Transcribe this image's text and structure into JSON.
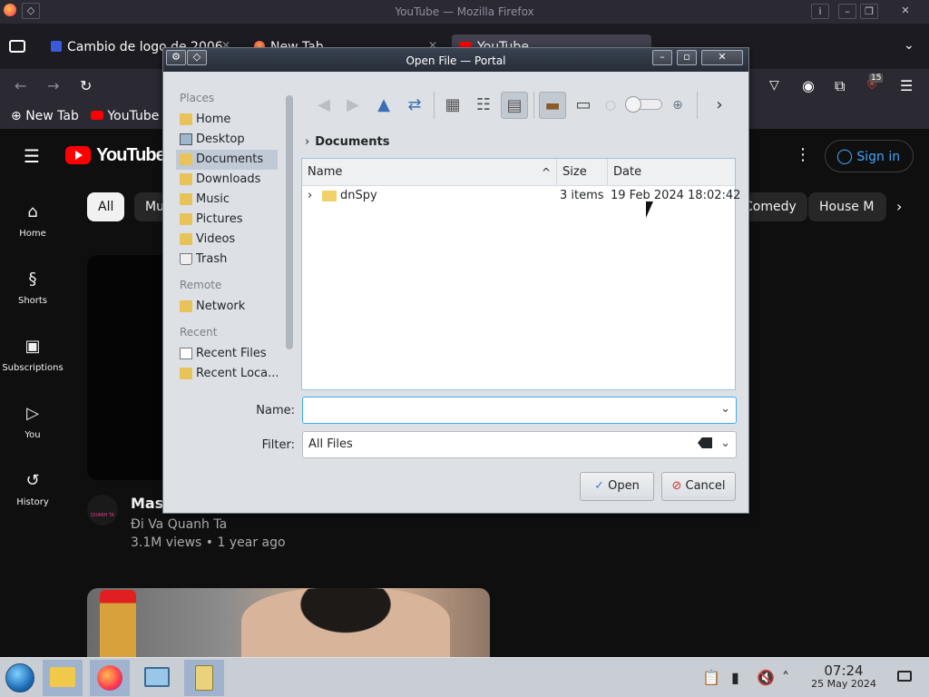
{
  "browser": {
    "window_title": "YouTube — Mozilla Firefox",
    "tabs": [
      {
        "label": "Cambio de logo de 2006"
      },
      {
        "label": "New Tab"
      },
      {
        "label": "YouTube"
      }
    ],
    "bookmarks": [
      {
        "label": "New Tab"
      },
      {
        "label": "YouTube"
      }
    ],
    "extension_badge": "15"
  },
  "youtube": {
    "logo_text": "YouTube",
    "sign_in": "Sign in",
    "chips": [
      "All",
      "Mu",
      "Comedy",
      "House M"
    ],
    "sidebar": [
      {
        "label": "Home"
      },
      {
        "label": "Shorts"
      },
      {
        "label": "Subscriptions"
      },
      {
        "label": "You"
      },
      {
        "label": "History"
      }
    ],
    "video1": {
      "title": "Mas",
      "channel": "Đi Va Quanh Ta",
      "meta": "3.1M views • 1 year ago",
      "avatar_text": "QUANH TA"
    }
  },
  "dialog": {
    "title": "Open File — Portal",
    "places_header": "Places",
    "places": [
      {
        "label": "Home"
      },
      {
        "label": "Desktop"
      },
      {
        "label": "Documents"
      },
      {
        "label": "Downloads"
      },
      {
        "label": "Music"
      },
      {
        "label": "Pictures"
      },
      {
        "label": "Videos"
      },
      {
        "label": "Trash"
      }
    ],
    "remote_header": "Remote",
    "remote": [
      {
        "label": "Network"
      }
    ],
    "recent_header": "Recent",
    "recent": [
      {
        "label": "Recent Files"
      },
      {
        "label": "Recent Loca..."
      }
    ],
    "breadcrumb": "Documents",
    "columns": {
      "name": "Name",
      "size": "Size",
      "date": "Date"
    },
    "files": [
      {
        "name": "dnSpy",
        "size": "3 items",
        "date": "19 Feb 2024 18:02:42"
      }
    ],
    "name_label": "Name:",
    "name_value": "",
    "filter_label": "Filter:",
    "filter_value": "All Files",
    "open_button": "Open",
    "cancel_button": "Cancel"
  },
  "taskbar": {
    "time": "07:24",
    "date": "25 May 2024"
  },
  "colors": {
    "youtube_red": "#ff0000",
    "selection": "#c0cad6",
    "focus": "#3daee9",
    "sign_in_blue": "#3ea6ff"
  }
}
